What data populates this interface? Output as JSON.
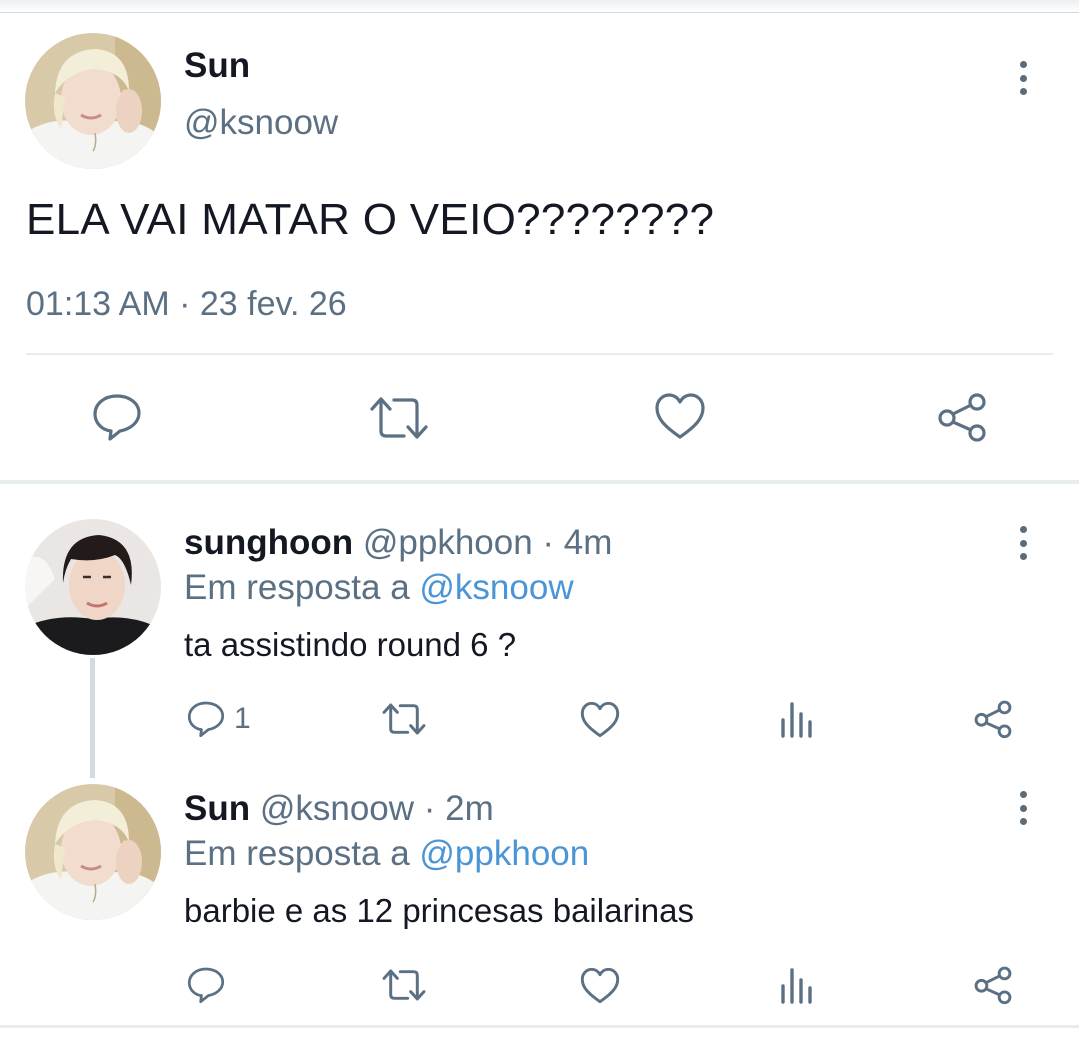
{
  "main_tweet": {
    "name": "Sun",
    "handle": "@ksnoow",
    "text": "ELA VAI MATAR O VEIO????????",
    "timestamp": "01:13 AM · 23 fev. 26",
    "actions": [
      "reply-icon",
      "retweet-icon",
      "like-icon",
      "share-icon"
    ]
  },
  "replies": [
    {
      "name": "sunghoon",
      "handle": "@ppkhoon",
      "time": "· 4m",
      "reply_prefix": "Em resposta a",
      "reply_to": "@ksnoow",
      "text": "ta assistindo round 6 ?",
      "reply_count": "1"
    },
    {
      "name": "Sun",
      "handle": "@ksnoow",
      "time": "· 2m",
      "reply_prefix": "Em resposta a",
      "reply_to": "@ppkhoon",
      "text": "barbie e as 12 princesas bailarinas"
    }
  ],
  "colors": {
    "text_primary": "#141823",
    "text_secondary": "#5b7083",
    "link": "#4a95d6",
    "divider": "#e6ecf0"
  }
}
